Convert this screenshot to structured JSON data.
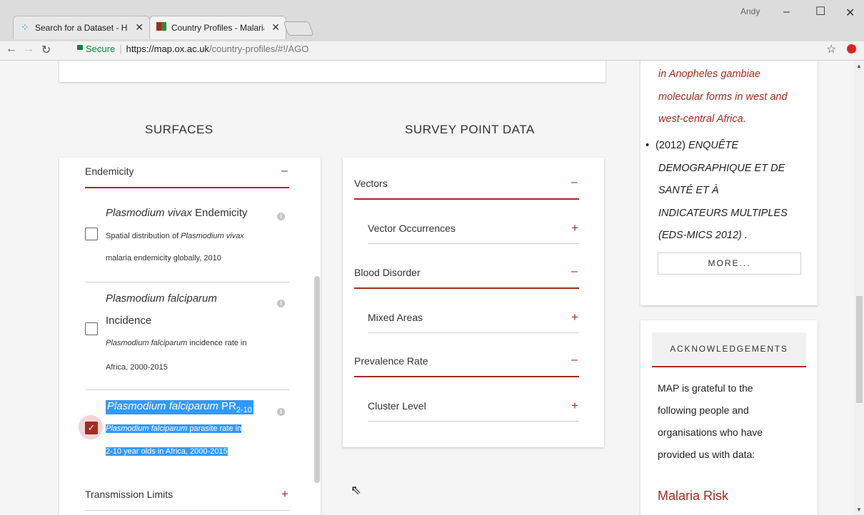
{
  "browser": {
    "tabs": [
      {
        "title": "Search for a Dataset - Hu"
      },
      {
        "title": "Country Profiles - Malaria"
      }
    ],
    "user": "Andy",
    "url": {
      "secure_label": "Secure",
      "host": "https://map.ox.ac.uk",
      "path": "/country-profiles/#!/AGO"
    }
  },
  "surfaces": {
    "heading": "SURFACES",
    "endemicity_label": "Endemicity",
    "items": [
      {
        "title_it": "Plasmodium vivax",
        "title_rest": " Endemicity",
        "desc_pre": "Spatial distribution of ",
        "desc_it": "Plasmodium vivax",
        "desc_post": "malaria endemicity globally, 2010",
        "checked": false
      },
      {
        "title_it": "Plasmodium falciparum",
        "title_rest": "Incidence",
        "desc_it": "Plasmodium falciparum",
        "desc_post": " incidence rate in",
        "desc_line2": "Africa, 2000-2015",
        "checked": false
      },
      {
        "title_it": "Plasmodium falciparum",
        "title_rest": " PR",
        "title_sub": "2-10",
        "desc_it": "Plasmodium falciparum",
        "desc_post": " parasite rate in",
        "desc_line2": "2-10 year olds in Africa, 2000-2015",
        "checked": true
      }
    ],
    "transmission_label": "Transmission Limits"
  },
  "survey": {
    "heading": "SURVEY POINT DATA",
    "groups": [
      {
        "label": "Vectors",
        "sub": "Vector Occurrences"
      },
      {
        "label": "Blood Disorder",
        "sub": "Mixed Areas"
      },
      {
        "label": "Prevalence Rate",
        "sub": "Cluster Level"
      }
    ]
  },
  "sidebar": {
    "ref1_lines": [
      "in Anopheles gambiae",
      "molecular forms in west and",
      "west-central Africa."
    ],
    "ref2_year": "(2012) ",
    "ref2_lines": [
      "ENQUÊTE",
      "DEMOGRAPHIQUE ET DE",
      "SANTÉ ET À",
      "INDICATEURS MULTIPLES",
      "(EDS-MICS 2012) ."
    ],
    "more_label": "MORE...",
    "ack_heading": "ACKNOWLEDGEMENTS",
    "ack_lines": [
      "MAP is grateful to the",
      "following people and",
      "organisations who have",
      "provided us with data:"
    ],
    "malaria_risk": "Malaria Risk"
  }
}
